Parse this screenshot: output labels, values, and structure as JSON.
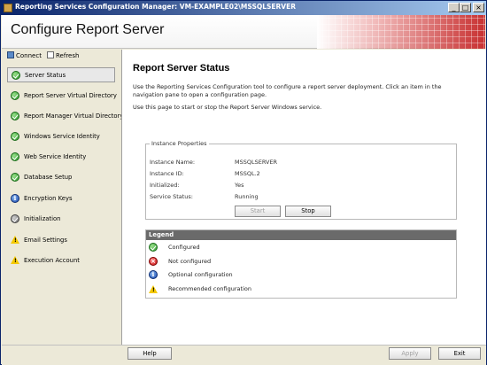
{
  "window": {
    "title": "Reporting Services Configuration Manager: VM-EXAMPLE02\\MSSQLSERVER",
    "minimize": "_",
    "maximize": "□",
    "close": "×"
  },
  "banner": {
    "heading": "Configure Report Server"
  },
  "toolbar": {
    "connect_label": "Connect",
    "refresh_label": "Refresh"
  },
  "nav": {
    "items": [
      {
        "label": "Server Status",
        "status": "ok",
        "selected": true
      },
      {
        "label": "Report Server Virtual Directory",
        "status": "ok"
      },
      {
        "label": "Report Manager Virtual Directory",
        "status": "ok"
      },
      {
        "label": "Windows Service Identity",
        "status": "ok"
      },
      {
        "label": "Web Service Identity",
        "status": "ok"
      },
      {
        "label": "Database Setup",
        "status": "ok"
      },
      {
        "label": "Encryption Keys",
        "status": "info"
      },
      {
        "label": "Initialization",
        "status": "gray"
      },
      {
        "label": "Email Settings",
        "status": "warn"
      },
      {
        "label": "Execution Account",
        "status": "warn"
      }
    ]
  },
  "main": {
    "title": "Report Server Status",
    "description1": "Use the Reporting Services Configuration tool to configure a report server deployment. Click an item in the navigation pane to open a configuration page.",
    "description2": "Use this page to start or stop the Report Server Windows service."
  },
  "instance": {
    "group_label": "Instance Properties",
    "rows": [
      {
        "key": "Instance Name:",
        "value": "MSSQLSERVER"
      },
      {
        "key": "Instance ID:",
        "value": "MSSQL.2"
      },
      {
        "key": "Initialized:",
        "value": "Yes"
      },
      {
        "key": "Service Status:",
        "value": "Running"
      }
    ],
    "start_label": "Start",
    "stop_label": "Stop"
  },
  "legend": {
    "header": "Legend",
    "items": [
      {
        "label": "Configured",
        "status": "ok"
      },
      {
        "label": "Not configured",
        "status": "err"
      },
      {
        "label": "Optional configuration",
        "status": "info"
      },
      {
        "label": "Recommended configuration",
        "status": "warn"
      }
    ]
  },
  "footer": {
    "help_label": "Help",
    "apply_label": "Apply",
    "exit_label": "Exit"
  },
  "icons": {
    "ok": "check-circle-icon",
    "err": "x-circle-icon",
    "info": "info-icon",
    "gray": "gray-check-icon",
    "warn": "warning-icon"
  }
}
